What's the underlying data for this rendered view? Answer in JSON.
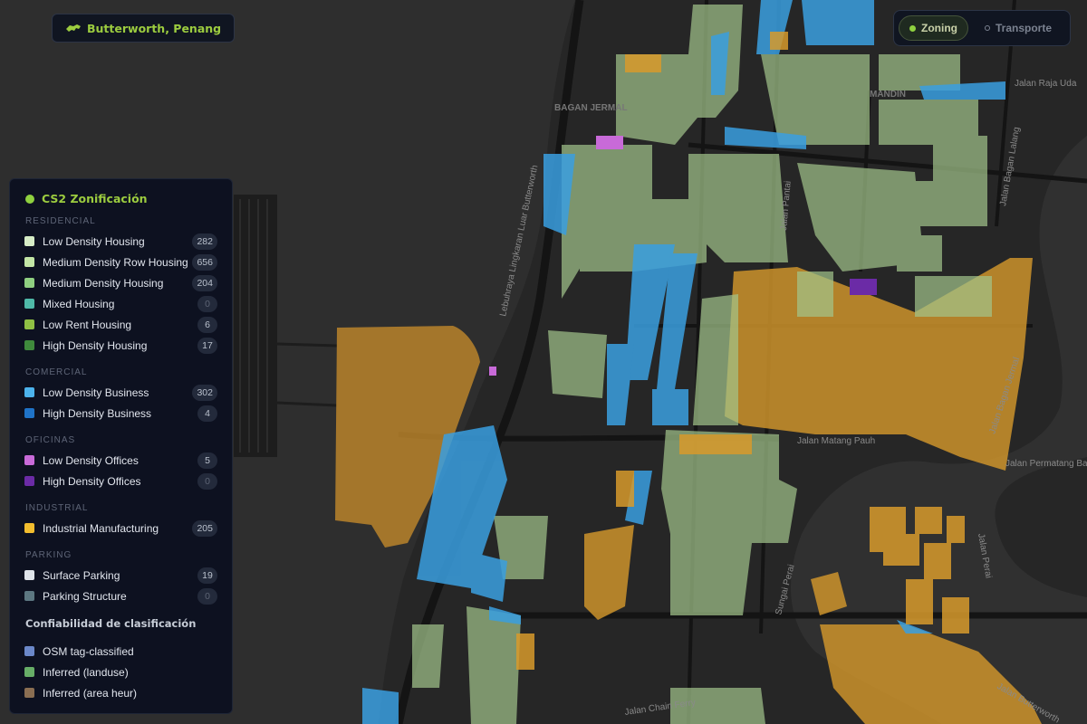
{
  "location": {
    "label": "Butterworth, Penang",
    "icon": "animal-icon"
  },
  "mode_toggle": {
    "buttons": [
      {
        "label": "Zoning",
        "active": true
      },
      {
        "label": "Transporte",
        "active": false
      }
    ]
  },
  "legend": {
    "title": "CS2 Zonificación",
    "sections": [
      {
        "header": "RESIDENCIAL",
        "items": [
          {
            "label": "Low Density Housing",
            "count": "282",
            "color": "#d6ecc6"
          },
          {
            "label": "Medium Density Row Housing",
            "count": "656",
            "color": "#c3e6a6"
          },
          {
            "label": "Medium Density Housing",
            "count": "204",
            "color": "#8fcf81"
          },
          {
            "label": "Mixed Housing",
            "count": "0",
            "color": "#4fb9a8"
          },
          {
            "label": "Low Rent Housing",
            "count": "6",
            "color": "#8fc044"
          },
          {
            "label": "High Density Housing",
            "count": "17",
            "color": "#3f8a3c"
          }
        ]
      },
      {
        "header": "COMERCIAL",
        "items": [
          {
            "label": "Low Density Business",
            "count": "302",
            "color": "#4cb3ec"
          },
          {
            "label": "High Density Business",
            "count": "4",
            "color": "#1f73c7"
          }
        ]
      },
      {
        "header": "OFICINAS",
        "items": [
          {
            "label": "Low Density Offices",
            "count": "5",
            "color": "#c86ad8"
          },
          {
            "label": "High Density Offices",
            "count": "0",
            "color": "#6b2ba6"
          }
        ]
      },
      {
        "header": "INDUSTRIAL",
        "items": [
          {
            "label": "Industrial Manufacturing",
            "count": "205",
            "color": "#f2bd2e"
          }
        ]
      },
      {
        "header": "PARKING",
        "items": [
          {
            "label": "Surface Parking",
            "count": "19",
            "color": "#dfe4ea"
          },
          {
            "label": "Parking Structure",
            "count": "0",
            "color": "#5c7781"
          }
        ]
      }
    ],
    "confidence": {
      "title": "Confiabilidad de clasificación",
      "items": [
        {
          "label": "OSM tag-classified",
          "color": "#6b88c9"
        },
        {
          "label": "Inferred (landuse)",
          "color": "#67ae67"
        },
        {
          "label": "Inferred (area heur)",
          "color": "#8a6e52"
        }
      ]
    }
  },
  "map": {
    "place_labels": [
      "BAGAN JERMAL",
      "MANDIN"
    ],
    "road_labels": [
      "Jalan Bagan Lalang",
      "Lebuhraya Lingkaran Luar Butterworth",
      "Jalan Perai",
      "Jalan Chain Ferry",
      "Sungai Perai",
      "Jalan Pantai",
      "Jalan Raja Uda",
      "Jalan Bagan Jermal",
      "Jalan Matang Pauh",
      "Jalan Butterworth",
      "Jalan Permatang Batu"
    ]
  }
}
